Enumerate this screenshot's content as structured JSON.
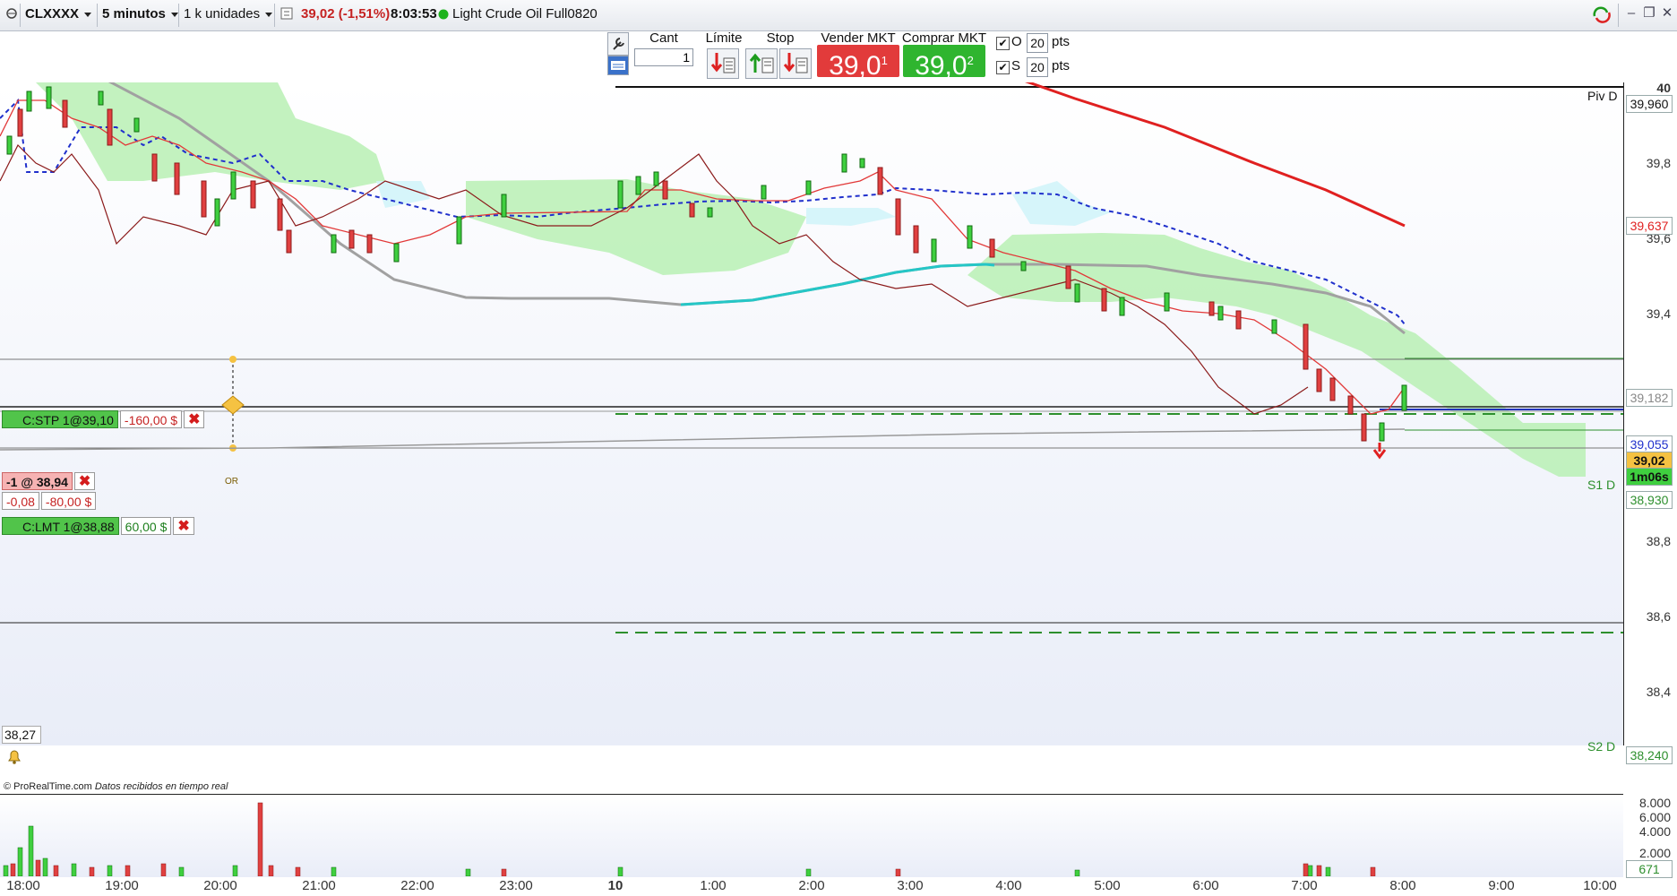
{
  "toolbar": {
    "symbol": "CLXXXX",
    "interval": "5 minutos",
    "units": "1 k unidades",
    "price_change": "39,02 (-1,51%)",
    "time": "8:03:53",
    "status_color": "#1db31d",
    "instrument": "Light Crude Oil Full0820"
  },
  "order_panel": {
    "qty_label": "Cant",
    "qty_value": "1",
    "limit_label": "Límite",
    "stop_label": "Stop",
    "sell_label": "Vender MKT",
    "sell_price": "39,0",
    "sell_super": "1",
    "buy_label": "Comprar MKT",
    "buy_price": "39,0",
    "buy_super": "2",
    "o_label": "O",
    "o_pts": "20",
    "s_label": "S",
    "s_pts": "20",
    "pts_label": "pts",
    "sell_color": "#e23b3b",
    "buy_color": "#2fb52f"
  },
  "chart": {
    "price_labels": [
      "40",
      "39,8",
      "39,6",
      "39,4",
      "38,8",
      "38,6",
      "38,4"
    ],
    "tags": {
      "piv_d": "39,960",
      "t1": "39,637",
      "t2": "39,182",
      "t3": "39,055",
      "last": "39,02",
      "timer": "1m06s",
      "s1": "38,930",
      "s2": "38,240",
      "vol_last": "671"
    },
    "level_labels": {
      "piv": "Piv D",
      "s1": "S1 D",
      "s2": "S2 D"
    },
    "low_label": "38,27",
    "orders": {
      "stop_label": "C:STP 1@39,10",
      "stop_pnl": "-160,00 $",
      "position_label": "-1 @ 38,94",
      "position_pts": "-0,08",
      "position_pnl": "-80,00 $",
      "limit_label": "C:LMT 1@38,88",
      "limit_pnl": "60,00 $",
      "oco_label": "OR"
    },
    "volume_labels": [
      "8.000",
      "6.000",
      "4.000",
      "2.000"
    ],
    "time_labels": [
      "18:00",
      "19:00",
      "20:00",
      "21:00",
      "22:00",
      "23:00",
      "10",
      "1:00",
      "2:00",
      "3:00",
      "4:00",
      "5:00",
      "6:00",
      "7:00",
      "8:00",
      "9:00",
      "10:00"
    ],
    "watermark_brand": "© ProRealTime.com",
    "watermark_text": "Datos recibidos en tiempo real"
  }
}
